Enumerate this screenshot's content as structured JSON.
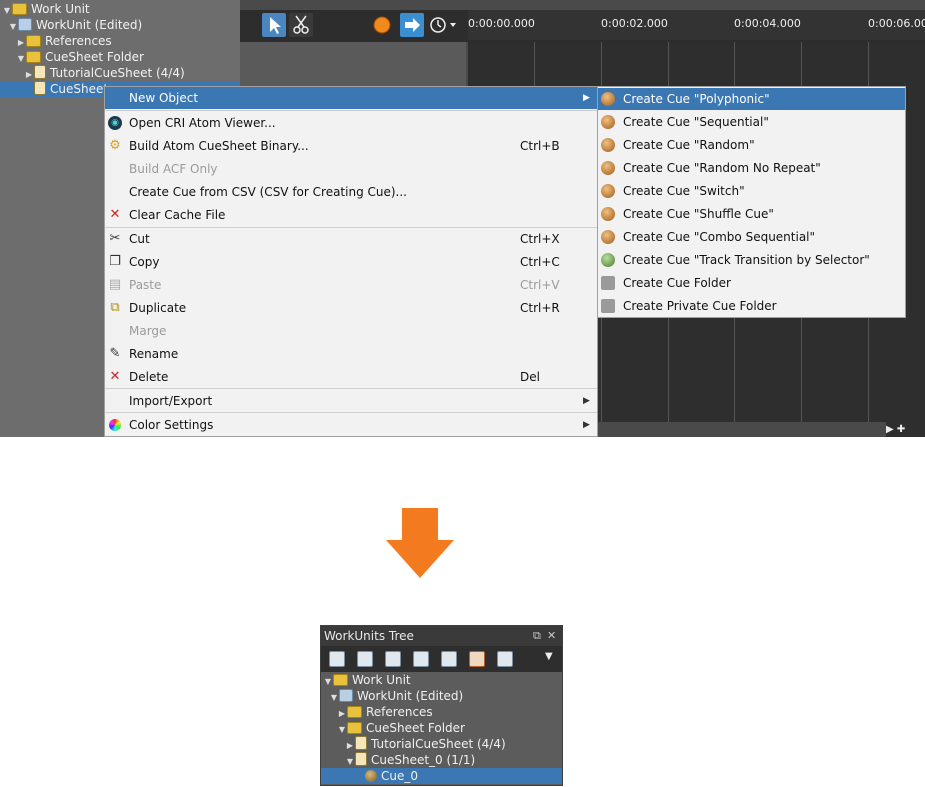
{
  "tree_top": {
    "rows": [
      {
        "label": "Work Unit"
      },
      {
        "label": "WorkUnit (Edited)"
      },
      {
        "label": "References"
      },
      {
        "label": "CueSheet Folder"
      },
      {
        "label": "TutorialCueSheet (4/4)"
      },
      {
        "label": "CueSheet"
      }
    ]
  },
  "timeline": {
    "ruler_labels": [
      "0:00:00.000",
      "0:00:02.000",
      "0:00:04.000",
      "0:00:06.000"
    ]
  },
  "context_menu": {
    "items": [
      {
        "label": "New Object",
        "shortcut": "",
        "has_submenu": true,
        "disabled": false,
        "icon": ""
      },
      {
        "label": "Open CRI Atom Viewer...",
        "shortcut": "",
        "disabled": false,
        "icon": "atom-viewer-icon"
      },
      {
        "label": "Build Atom CueSheet Binary...",
        "shortcut": "Ctrl+B",
        "disabled": false,
        "icon": "build-icon"
      },
      {
        "label": "Build ACF Only",
        "shortcut": "",
        "disabled": true,
        "icon": ""
      },
      {
        "label": "Create Cue from CSV (CSV for Creating Cue)...",
        "shortcut": "",
        "disabled": false,
        "icon": ""
      },
      {
        "label": "Clear Cache File",
        "shortcut": "",
        "disabled": false,
        "icon": "red-x-icon"
      },
      {
        "label": "Cut",
        "shortcut": "Ctrl+X",
        "disabled": false,
        "icon": "scissors-icon"
      },
      {
        "label": "Copy",
        "shortcut": "Ctrl+C",
        "disabled": false,
        "icon": "copy-icon"
      },
      {
        "label": "Paste",
        "shortcut": "Ctrl+V",
        "disabled": true,
        "icon": "paste-icon"
      },
      {
        "label": "Duplicate",
        "shortcut": "Ctrl+R",
        "disabled": false,
        "icon": "duplicate-icon"
      },
      {
        "label": "Marge",
        "shortcut": "",
        "disabled": true,
        "icon": ""
      },
      {
        "label": "Rename",
        "shortcut": "",
        "disabled": false,
        "icon": "pencil-icon"
      },
      {
        "label": "Delete",
        "shortcut": "Del",
        "disabled": false,
        "icon": "red-x-icon"
      },
      {
        "label": "Import/Export",
        "shortcut": "",
        "has_submenu": true,
        "disabled": false,
        "icon": ""
      },
      {
        "label": "Color Settings",
        "shortcut": "",
        "has_submenu": true,
        "disabled": false,
        "icon": "color-wheel-icon"
      }
    ]
  },
  "submenu": {
    "items": [
      {
        "label": "Create Cue \"Polyphonic\""
      },
      {
        "label": "Create Cue \"Sequential\""
      },
      {
        "label": "Create Cue \"Random\""
      },
      {
        "label": "Create Cue \"Random No Repeat\""
      },
      {
        "label": "Create Cue \"Switch\""
      },
      {
        "label": "Create Cue \"Shuffle Cue\""
      },
      {
        "label": "Create Cue \"Combo Sequential\""
      },
      {
        "label": "Create Cue \"Track Transition by Selector\""
      },
      {
        "label": "Create Cue Folder"
      },
      {
        "label": "Create Private Cue Folder"
      }
    ]
  },
  "panel": {
    "title": "WorkUnits Tree",
    "rows": [
      {
        "label": "Work Unit"
      },
      {
        "label": "WorkUnit (Edited)"
      },
      {
        "label": "References"
      },
      {
        "label": "CueSheet Folder"
      },
      {
        "label": "TutorialCueSheet (4/4)"
      },
      {
        "label": "CueSheet_0 (1/1)"
      },
      {
        "label": "Cue_0"
      }
    ]
  },
  "colors": {
    "selection": "#3b78b3",
    "arrow": "#f47a20"
  }
}
